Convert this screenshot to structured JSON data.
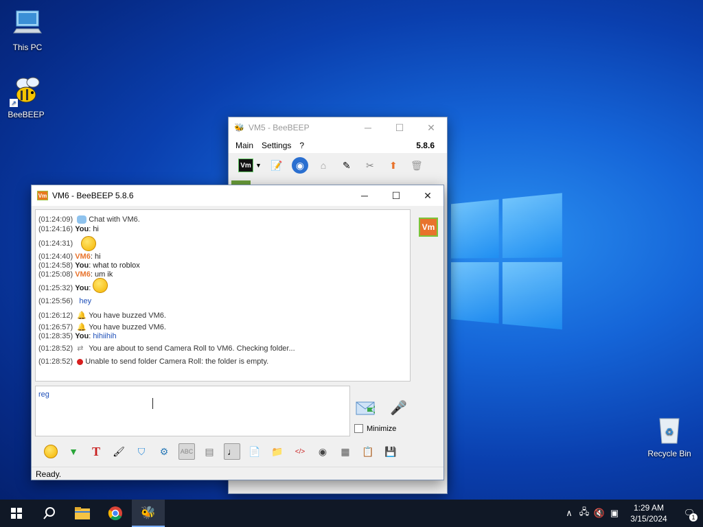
{
  "desktop": {
    "icons": [
      {
        "label": "This PC"
      },
      {
        "label": "BeeBEEP"
      },
      {
        "label": "Recycle Bin"
      }
    ]
  },
  "back_window": {
    "title": "VM5 - BeeBEEP",
    "menu": [
      "Main",
      "Settings",
      "?"
    ],
    "version": "5.8.6",
    "user_badge": "Vm"
  },
  "chat_window": {
    "title": "VM6 - BeeBEEP 5.8.6",
    "badge": "Vm",
    "side_badge": "Vm",
    "messages": [
      {
        "ts": "(01:24:09)",
        "kind": "sys",
        "text": "Chat with VM6."
      },
      {
        "ts": "(01:24:16)",
        "kind": "me",
        "who": "You",
        "text": "hi"
      },
      {
        "ts": "(01:24:31)",
        "kind": "emoji",
        "who": "",
        "text": ""
      },
      {
        "ts": "(01:24:40)",
        "kind": "peer",
        "who": "VM6",
        "text": "hi"
      },
      {
        "ts": "(01:24:58)",
        "kind": "me",
        "who": "You",
        "text": "what to roblox"
      },
      {
        "ts": "(01:25:08)",
        "kind": "peer",
        "who": "VM6",
        "text": "um ik"
      },
      {
        "ts": "(01:25:32)",
        "kind": "me-emoji",
        "who": "You",
        "text": ""
      },
      {
        "ts": "(01:25:56)",
        "kind": "blue",
        "who": "",
        "text": "hey"
      },
      {
        "ts": "(01:26:12)",
        "kind": "buzz",
        "text": "You have buzzed VM6."
      },
      {
        "ts": "(01:26:57)",
        "kind": "buzz",
        "text": "You have buzzed VM6."
      },
      {
        "ts": "(01:28:35)",
        "kind": "me-blue",
        "who": "You",
        "text": "hihiihih"
      },
      {
        "ts": "(01:28:52)",
        "kind": "send",
        "text": "You are about to send Camera Roll to VM6. Checking folder..."
      },
      {
        "ts": "(01:28:52)",
        "kind": "error",
        "text": "Unable to send folder Camera Roll: the folder is empty."
      }
    ],
    "input_value": "reg",
    "minimize_label": "Minimize",
    "status": "Ready."
  },
  "taskbar": {
    "time": "1:29 AM",
    "date": "3/15/2024",
    "notifications": "1"
  },
  "colors": {
    "peer": "#e8732c",
    "link": "#1e4fb8",
    "badge": "#e87a1e"
  }
}
